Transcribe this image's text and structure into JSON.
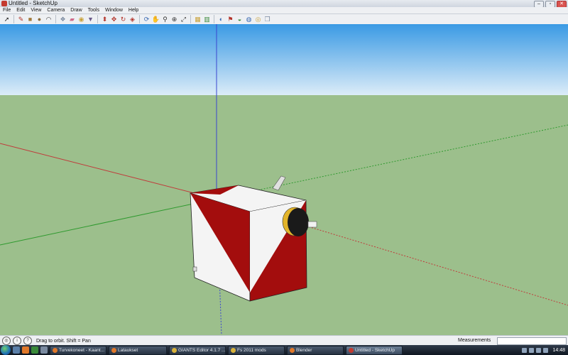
{
  "window": {
    "title": "Untitled - SketchUp"
  },
  "menu": [
    "File",
    "Edit",
    "View",
    "Camera",
    "Draw",
    "Tools",
    "Window",
    "Help"
  ],
  "toolbar": [
    {
      "name": "select-icon",
      "glyph": "➚",
      "color": "#222222"
    },
    {
      "name": "sep"
    },
    {
      "name": "pencil-icon",
      "glyph": "✎",
      "color": "#b3332a"
    },
    {
      "name": "rectangle-icon",
      "glyph": "■",
      "color": "#a07a3a"
    },
    {
      "name": "circle-icon",
      "glyph": "●",
      "color": "#8a6a3a"
    },
    {
      "name": "arc-icon",
      "glyph": "◠",
      "color": "#333333"
    },
    {
      "name": "sep"
    },
    {
      "name": "make-component-icon",
      "glyph": "❖",
      "color": "#7a8aa0"
    },
    {
      "name": "eraser-icon",
      "glyph": "▰",
      "color": "#d06a8a"
    },
    {
      "name": "tape-measure-icon",
      "glyph": "◉",
      "color": "#c9a23a"
    },
    {
      "name": "paint-bucket-icon",
      "glyph": "▼",
      "color": "#6a5a8a"
    },
    {
      "name": "sep"
    },
    {
      "name": "push-pull-icon",
      "glyph": "⬍",
      "color": "#b3332a"
    },
    {
      "name": "move-icon",
      "glyph": "✥",
      "color": "#b3332a"
    },
    {
      "name": "rotate-icon",
      "glyph": "↻",
      "color": "#b3332a"
    },
    {
      "name": "offset-icon",
      "glyph": "◈",
      "color": "#b3332a"
    },
    {
      "name": "sep"
    },
    {
      "name": "orbit-icon",
      "glyph": "⟳",
      "color": "#3a6ab3"
    },
    {
      "name": "pan-icon",
      "glyph": "✋",
      "color": "#a07a3a"
    },
    {
      "name": "zoom-icon",
      "glyph": "⚲",
      "color": "#333333"
    },
    {
      "name": "zoom-window-icon",
      "glyph": "⊕",
      "color": "#333333"
    },
    {
      "name": "zoom-extents-icon",
      "glyph": "⤢",
      "color": "#333333"
    },
    {
      "name": "sep"
    },
    {
      "name": "get-models-icon",
      "glyph": "▦",
      "color": "#c9a23a"
    },
    {
      "name": "share-model-icon",
      "glyph": "▥",
      "color": "#3a8a3a"
    },
    {
      "name": "sep"
    },
    {
      "name": "get-photo-texture-icon",
      "glyph": "◐",
      "color": "#3a6ab3"
    },
    {
      "name": "add-location-icon",
      "glyph": "⚑",
      "color": "#b3332a"
    },
    {
      "name": "toggle-terrain-icon",
      "glyph": "◒",
      "color": "#3a8a3a"
    },
    {
      "name": "preview-google-earth-icon",
      "glyph": "◍",
      "color": "#3a6ab3"
    },
    {
      "name": "get-current-view-icon",
      "glyph": "◎",
      "color": "#c9a23a"
    },
    {
      "name": "components-icon",
      "glyph": "❒",
      "color": "#7a8aa0"
    }
  ],
  "status": {
    "hint": "Drag to orbit.  Shift = Pan",
    "measurements_label": "Measurements",
    "measurements_value": ""
  },
  "taskbar": {
    "items": [
      {
        "label": "Turvekoneet - Kaant...",
        "color": "#e0782a",
        "active": false
      },
      {
        "label": "Lataukset",
        "color": "#e0782a",
        "active": false
      },
      {
        "label": "GIANTS Editor 4.1.7 ...",
        "color": "#d8b23a",
        "active": false
      },
      {
        "label": "Fs 2011 mods",
        "color": "#d8b23a",
        "active": false
      },
      {
        "label": "Blender",
        "color": "#e0782a",
        "active": false
      },
      {
        "label": "Untitled - SketchUp",
        "color": "#c43a2f",
        "active": true
      }
    ],
    "clock": "14:48"
  },
  "colors": {
    "sky_top": "#3a9ae4",
    "sky_bottom": "#dcecf8",
    "ground": "#9cbf8c",
    "model_red": "#a30d0d",
    "model_white": "#f4f4f4",
    "axis_red": "#c03b3b",
    "axis_green": "#2f9a2f",
    "axis_blue": "#3a46d0"
  }
}
